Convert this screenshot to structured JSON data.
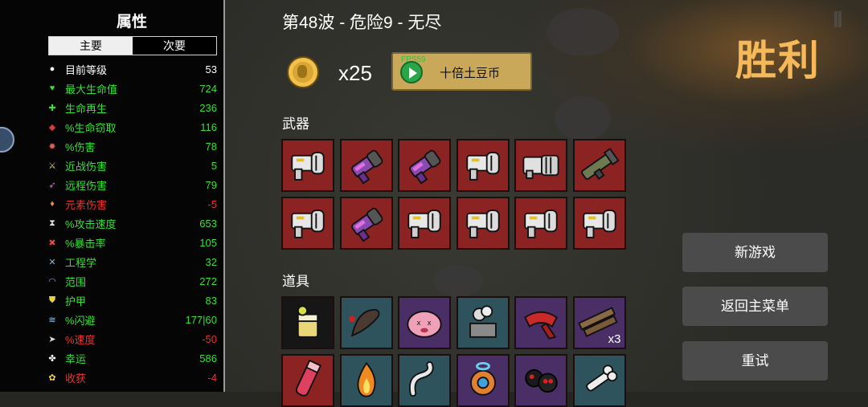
{
  "stats_panel": {
    "title": "属性",
    "tabs": [
      "主要",
      "次要"
    ],
    "stats": [
      {
        "icon": "level-icon",
        "name": "目前等级",
        "value": "53",
        "color": "#ffffff"
      },
      {
        "icon": "heart-icon",
        "name": "最大生命值",
        "value": "724",
        "color": "#33e233"
      },
      {
        "icon": "regen-icon",
        "name": "生命再生",
        "value": "236",
        "color": "#33e233"
      },
      {
        "icon": "lifesteal-icon",
        "name": "%生命窃取",
        "value": "116",
        "color": "#33e233"
      },
      {
        "icon": "damage-icon",
        "name": "%伤害",
        "value": "78",
        "color": "#33e233"
      },
      {
        "icon": "melee-icon",
        "name": "近战伤害",
        "value": "5",
        "color": "#33e233"
      },
      {
        "icon": "ranged-icon",
        "name": "远程伤害",
        "value": "79",
        "color": "#33e233"
      },
      {
        "icon": "elemental-icon",
        "name": "元素伤害",
        "value": "-5",
        "color": "#ee3030"
      },
      {
        "icon": "attack-speed-icon",
        "name": "%攻击速度",
        "value": "653",
        "color": "#33e233"
      },
      {
        "icon": "crit-icon",
        "name": "%暴击率",
        "value": "105",
        "color": "#33e233"
      },
      {
        "icon": "engineering-icon",
        "name": "工程学",
        "value": "32",
        "color": "#33e233"
      },
      {
        "icon": "range-icon",
        "name": "范围",
        "value": "272",
        "color": "#33e233"
      },
      {
        "icon": "armor-icon",
        "name": "护甲",
        "value": "83",
        "color": "#33e233"
      },
      {
        "icon": "dodge-icon",
        "name": "%闪避",
        "value": "177|60",
        "color": "#33e233"
      },
      {
        "icon": "speed-icon",
        "name": "%速度",
        "value": "-50",
        "color": "#ee3030"
      },
      {
        "icon": "luck-icon",
        "name": "幸运",
        "value": "586",
        "color": "#33e233"
      },
      {
        "icon": "harvest-icon",
        "name": "收获",
        "value": "-4",
        "color": "#ee3030"
      }
    ]
  },
  "header": {
    "wave_text": "第48波 - 危险9 - 无尽"
  },
  "potato": {
    "multiplier": "x25",
    "button_label": "十倍土豆币",
    "fps": "FPS59"
  },
  "weapons": {
    "title": "武器",
    "items": [
      {
        "icon": "smg-icon",
        "tier": "red"
      },
      {
        "icon": "laser-gun-icon",
        "tier": "red"
      },
      {
        "icon": "laser-gun-icon",
        "tier": "red"
      },
      {
        "icon": "smg-icon",
        "tier": "red"
      },
      {
        "icon": "minigun-icon",
        "tier": "red"
      },
      {
        "icon": "rocket-launcher-icon",
        "tier": "red"
      },
      {
        "icon": "smg-icon",
        "tier": "red"
      },
      {
        "icon": "laser-gun-icon",
        "tier": "red"
      },
      {
        "icon": "smg-icon",
        "tier": "red"
      },
      {
        "icon": "smg-icon",
        "tier": "red"
      },
      {
        "icon": "smg-icon",
        "tier": "red"
      },
      {
        "icon": "smg-icon",
        "tier": "red"
      }
    ]
  },
  "items": {
    "title": "道具",
    "list": [
      {
        "icon": "juice-icon",
        "tier": "dark",
        "count": ""
      },
      {
        "icon": "leech-icon",
        "tier": "teal",
        "count": ""
      },
      {
        "icon": "pink-blob-icon",
        "tier": "purple",
        "count": ""
      },
      {
        "icon": "explosion-ruins-icon",
        "tier": "teal",
        "count": ""
      },
      {
        "icon": "red-scarf-icon",
        "tier": "purple",
        "count": ""
      },
      {
        "icon": "wood-planks-icon",
        "tier": "purple",
        "count": "x3"
      },
      {
        "icon": "potion-icon",
        "tier": "red",
        "count": ""
      },
      {
        "icon": "fire-icon",
        "tier": "teal",
        "count": ""
      },
      {
        "icon": "worm-icon",
        "tier": "teal",
        "count": ""
      },
      {
        "icon": "robot-icon",
        "tier": "purple",
        "count": ""
      },
      {
        "icon": "dark-creatures-icon",
        "tier": "purple",
        "count": ""
      },
      {
        "icon": "bone-icon",
        "tier": "teal",
        "count": ""
      }
    ]
  },
  "result": {
    "title": "胜利"
  },
  "buttons": {
    "new_game": "新游戏",
    "main_menu": "返回主菜单",
    "retry": "重试"
  },
  "colors": {
    "accent_victory": "#f5b95a",
    "tier_red": "#8b2323",
    "tier_purple": "#4a2e66",
    "tier_teal": "#2f535c",
    "positive": "#33e233",
    "negative": "#ee3030"
  }
}
